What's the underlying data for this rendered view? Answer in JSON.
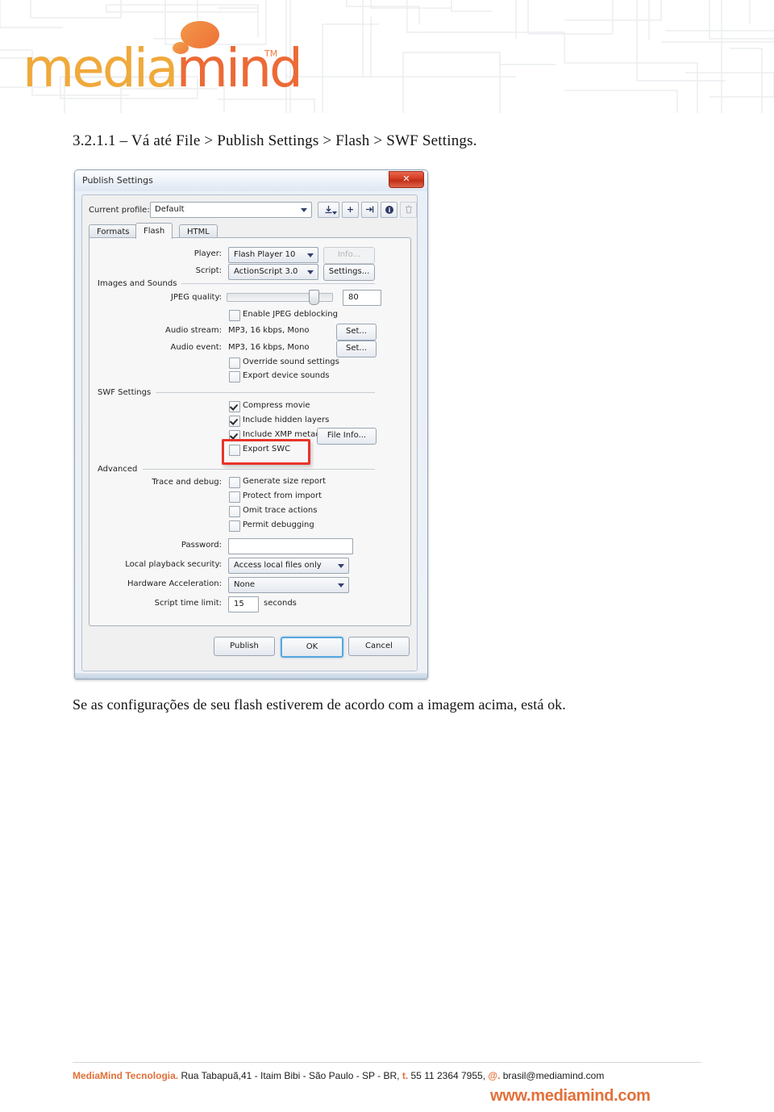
{
  "brand": {
    "logo_text_part1": "media",
    "logo_text_part2": "mind",
    "trademark": "TM",
    "color_yellow": "#f0a93b",
    "color_orange": "#ec6a36"
  },
  "document": {
    "heading": "3.2.1.1 – Vá até File > Publish Settings > Flash > SWF Settings.",
    "caption": "Se as configurações de seu flash estiverem de acordo com a imagem acima, está ok."
  },
  "dialog": {
    "title": "Publish Settings",
    "close_label": "✕",
    "profile": {
      "label": "Current profile:",
      "value": "Default",
      "tools": [
        {
          "name": "import-profile-icon",
          "glyph": "⤓"
        },
        {
          "name": "add-profile-icon",
          "glyph": "+"
        },
        {
          "name": "export-profile-icon",
          "glyph": "⇥"
        },
        {
          "name": "profile-info-icon",
          "glyph": "i"
        },
        {
          "name": "delete-profile-icon",
          "glyph": "⌧"
        }
      ]
    },
    "tabs": [
      {
        "label": "Formats",
        "active": false
      },
      {
        "label": "Flash",
        "active": true
      },
      {
        "label": "HTML",
        "active": false
      }
    ],
    "player": {
      "label": "Player:",
      "value": "Flash Player 10",
      "button": "Info..."
    },
    "script": {
      "label": "Script:",
      "value": "ActionScript 3.0",
      "button": "Settings..."
    },
    "section_images_sounds": "Images and Sounds",
    "jpeg_quality": {
      "label": "JPEG quality:",
      "value": "80",
      "slider_percent": 80
    },
    "enable_jpeg_deblocking": {
      "label": "Enable JPEG deblocking",
      "checked": false
    },
    "audio_stream": {
      "label": "Audio stream:",
      "value": "MP3, 16 kbps, Mono",
      "button": "Set..."
    },
    "audio_event": {
      "label": "Audio event:",
      "value": "MP3, 16 kbps, Mono",
      "button": "Set..."
    },
    "override_sound_settings": {
      "label": "Override sound settings",
      "checked": false
    },
    "export_device_sounds": {
      "label": "Export device sounds",
      "checked": false
    },
    "section_swf_settings": "SWF Settings",
    "compress_movie": {
      "label": "Compress movie",
      "checked": true
    },
    "include_hidden_layers": {
      "label": "Include hidden layers",
      "checked": true
    },
    "include_xmp_metadata": {
      "label": "Include XMP metadata",
      "checked": true
    },
    "file_info_button": "File Info...",
    "export_swc": {
      "label": "Export SWC",
      "checked": false,
      "highlighted": true
    },
    "highlight_color": "#e8342a",
    "section_advanced": "Advanced",
    "trace_and_debug_label": "Trace and debug:",
    "generate_size_report": {
      "label": "Generate size report",
      "checked": false
    },
    "protect_from_import": {
      "label": "Protect from import",
      "checked": false
    },
    "omit_trace_actions": {
      "label": "Omit trace actions",
      "checked": false
    },
    "permit_debugging": {
      "label": "Permit debugging",
      "checked": false
    },
    "password": {
      "label": "Password:",
      "value": ""
    },
    "local_playback_security": {
      "label": "Local playback security:",
      "value": "Access local files only"
    },
    "hardware_acceleration": {
      "label": "Hardware Acceleration:",
      "value": "None"
    },
    "script_time_limit": {
      "label": "Script time limit:",
      "value": "15",
      "units": "seconds"
    },
    "footer_buttons": {
      "publish": "Publish",
      "ok": "OK",
      "cancel": "Cancel"
    }
  },
  "footer": {
    "org": "MediaMind Tecnologia.",
    "address": " Rua Tabapuã,41 - Itaim Bibi - São Paulo - SP - BR, ",
    "phone_prefix": "t.",
    "phone": " 55 11 2364 7955, ",
    "email_prefix": "@.",
    "email": " brasil@mediamind.com",
    "url": "www.mediamind.com",
    "accent_color": "#e2703a"
  }
}
